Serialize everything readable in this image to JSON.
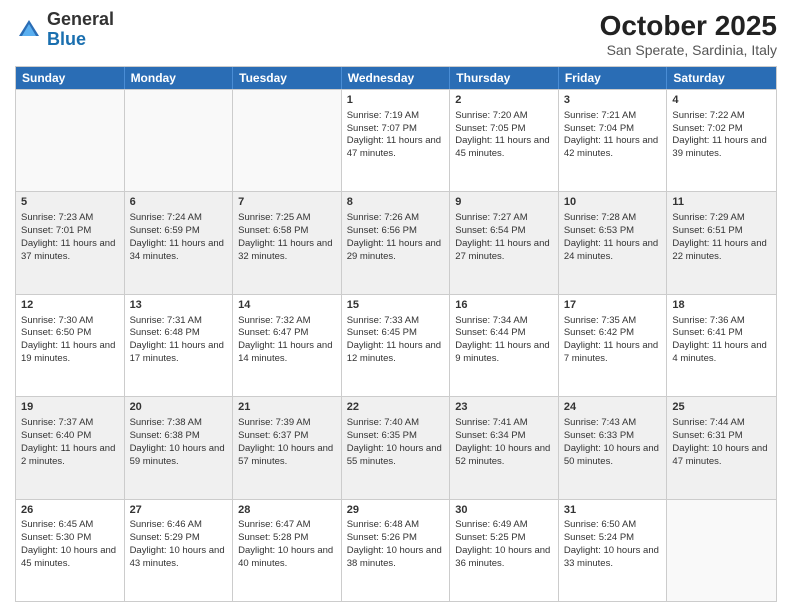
{
  "header": {
    "logo": {
      "line1": "General",
      "line2": "Blue"
    },
    "title": "October 2025",
    "location": "San Sperate, Sardinia, Italy"
  },
  "days_of_week": [
    "Sunday",
    "Monday",
    "Tuesday",
    "Wednesday",
    "Thursday",
    "Friday",
    "Saturday"
  ],
  "weeks": [
    [
      {
        "day": "",
        "empty": true
      },
      {
        "day": "",
        "empty": true
      },
      {
        "day": "",
        "empty": true
      },
      {
        "day": "1",
        "sunrise": "7:19 AM",
        "sunset": "7:07 PM",
        "daylight": "11 hours and 47 minutes."
      },
      {
        "day": "2",
        "sunrise": "7:20 AM",
        "sunset": "7:05 PM",
        "daylight": "11 hours and 45 minutes."
      },
      {
        "day": "3",
        "sunrise": "7:21 AM",
        "sunset": "7:04 PM",
        "daylight": "11 hours and 42 minutes."
      },
      {
        "day": "4",
        "sunrise": "7:22 AM",
        "sunset": "7:02 PM",
        "daylight": "11 hours and 39 minutes."
      }
    ],
    [
      {
        "day": "5",
        "sunrise": "7:23 AM",
        "sunset": "7:01 PM",
        "daylight": "11 hours and 37 minutes."
      },
      {
        "day": "6",
        "sunrise": "7:24 AM",
        "sunset": "6:59 PM",
        "daylight": "11 hours and 34 minutes."
      },
      {
        "day": "7",
        "sunrise": "7:25 AM",
        "sunset": "6:58 PM",
        "daylight": "11 hours and 32 minutes."
      },
      {
        "day": "8",
        "sunrise": "7:26 AM",
        "sunset": "6:56 PM",
        "daylight": "11 hours and 29 minutes."
      },
      {
        "day": "9",
        "sunrise": "7:27 AM",
        "sunset": "6:54 PM",
        "daylight": "11 hours and 27 minutes."
      },
      {
        "day": "10",
        "sunrise": "7:28 AM",
        "sunset": "6:53 PM",
        "daylight": "11 hours and 24 minutes."
      },
      {
        "day": "11",
        "sunrise": "7:29 AM",
        "sunset": "6:51 PM",
        "daylight": "11 hours and 22 minutes."
      }
    ],
    [
      {
        "day": "12",
        "sunrise": "7:30 AM",
        "sunset": "6:50 PM",
        "daylight": "11 hours and 19 minutes."
      },
      {
        "day": "13",
        "sunrise": "7:31 AM",
        "sunset": "6:48 PM",
        "daylight": "11 hours and 17 minutes."
      },
      {
        "day": "14",
        "sunrise": "7:32 AM",
        "sunset": "6:47 PM",
        "daylight": "11 hours and 14 minutes."
      },
      {
        "day": "15",
        "sunrise": "7:33 AM",
        "sunset": "6:45 PM",
        "daylight": "11 hours and 12 minutes."
      },
      {
        "day": "16",
        "sunrise": "7:34 AM",
        "sunset": "6:44 PM",
        "daylight": "11 hours and 9 minutes."
      },
      {
        "day": "17",
        "sunrise": "7:35 AM",
        "sunset": "6:42 PM",
        "daylight": "11 hours and 7 minutes."
      },
      {
        "day": "18",
        "sunrise": "7:36 AM",
        "sunset": "6:41 PM",
        "daylight": "11 hours and 4 minutes."
      }
    ],
    [
      {
        "day": "19",
        "sunrise": "7:37 AM",
        "sunset": "6:40 PM",
        "daylight": "11 hours and 2 minutes."
      },
      {
        "day": "20",
        "sunrise": "7:38 AM",
        "sunset": "6:38 PM",
        "daylight": "10 hours and 59 minutes."
      },
      {
        "day": "21",
        "sunrise": "7:39 AM",
        "sunset": "6:37 PM",
        "daylight": "10 hours and 57 minutes."
      },
      {
        "day": "22",
        "sunrise": "7:40 AM",
        "sunset": "6:35 PM",
        "daylight": "10 hours and 55 minutes."
      },
      {
        "day": "23",
        "sunrise": "7:41 AM",
        "sunset": "6:34 PM",
        "daylight": "10 hours and 52 minutes."
      },
      {
        "day": "24",
        "sunrise": "7:43 AM",
        "sunset": "6:33 PM",
        "daylight": "10 hours and 50 minutes."
      },
      {
        "day": "25",
        "sunrise": "7:44 AM",
        "sunset": "6:31 PM",
        "daylight": "10 hours and 47 minutes."
      }
    ],
    [
      {
        "day": "26",
        "sunrise": "6:45 AM",
        "sunset": "5:30 PM",
        "daylight": "10 hours and 45 minutes."
      },
      {
        "day": "27",
        "sunrise": "6:46 AM",
        "sunset": "5:29 PM",
        "daylight": "10 hours and 43 minutes."
      },
      {
        "day": "28",
        "sunrise": "6:47 AM",
        "sunset": "5:28 PM",
        "daylight": "10 hours and 40 minutes."
      },
      {
        "day": "29",
        "sunrise": "6:48 AM",
        "sunset": "5:26 PM",
        "daylight": "10 hours and 38 minutes."
      },
      {
        "day": "30",
        "sunrise": "6:49 AM",
        "sunset": "5:25 PM",
        "daylight": "10 hours and 36 minutes."
      },
      {
        "day": "31",
        "sunrise": "6:50 AM",
        "sunset": "5:24 PM",
        "daylight": "10 hours and 33 minutes."
      },
      {
        "day": "",
        "empty": true
      }
    ]
  ],
  "labels": {
    "sunrise": "Sunrise:",
    "sunset": "Sunset:",
    "daylight": "Daylight:"
  }
}
